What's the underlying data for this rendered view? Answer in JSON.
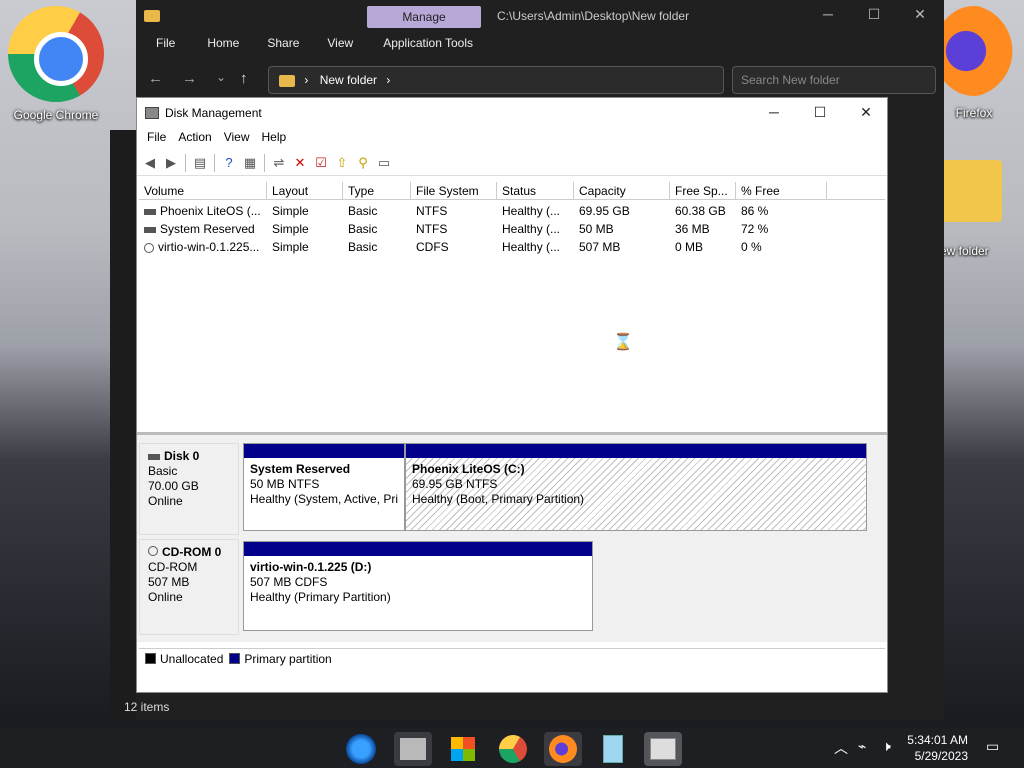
{
  "desktop": {
    "icons": [
      {
        "label": "Google Chrome"
      },
      {
        "label": "Firefox"
      },
      {
        "label": "New folder"
      }
    ]
  },
  "explorer": {
    "tab_manage": "Manage",
    "path_title": "C:\\Users\\Admin\\Desktop\\New folder",
    "ribbon": [
      "File",
      "Home",
      "Share",
      "View",
      "Application Tools"
    ],
    "address": "New folder",
    "search_placeholder": "Search New folder",
    "status_items": "12 items"
  },
  "disk_mgmt": {
    "title": "Disk Management",
    "menu": [
      "File",
      "Action",
      "View",
      "Help"
    ],
    "columns": [
      "Volume",
      "Layout",
      "Type",
      "File System",
      "Status",
      "Capacity",
      "Free Sp...",
      "% Free"
    ],
    "rows": [
      [
        "Phoenix LiteOS (...",
        "Simple",
        "Basic",
        "NTFS",
        "Healthy (...",
        "69.95 GB",
        "60.38 GB",
        "86 %"
      ],
      [
        "System Reserved",
        "Simple",
        "Basic",
        "NTFS",
        "Healthy (...",
        "50 MB",
        "36 MB",
        "72 %"
      ],
      [
        "virtio-win-0.1.225...",
        "Simple",
        "Basic",
        "CDFS",
        "Healthy (...",
        "507 MB",
        "0 MB",
        "0 %"
      ]
    ],
    "disks": [
      {
        "name": "Disk 0",
        "type": "Basic",
        "size": "70.00 GB",
        "state": "Online",
        "partitions": [
          {
            "name": "System Reserved",
            "size": "50 MB NTFS",
            "status": "Healthy (System, Active, Pri"
          },
          {
            "name": "Phoenix LiteOS  (C:)",
            "size": "69.95 GB NTFS",
            "status": "Healthy (Boot, Primary Partition)"
          }
        ]
      },
      {
        "name": "CD-ROM 0",
        "type": "CD-ROM",
        "size": "507 MB",
        "state": "Online",
        "partitions": [
          {
            "name": "virtio-win-0.1.225  (D:)",
            "size": "507 MB CDFS",
            "status": "Healthy (Primary Partition)"
          }
        ]
      }
    ],
    "legend": [
      "Unallocated",
      "Primary partition"
    ],
    "colors": {
      "primary": "#00008b",
      "unallocated": "#000000"
    }
  },
  "taskbar": {
    "time": "5:34:01 AM",
    "date": "5/29/2023"
  }
}
